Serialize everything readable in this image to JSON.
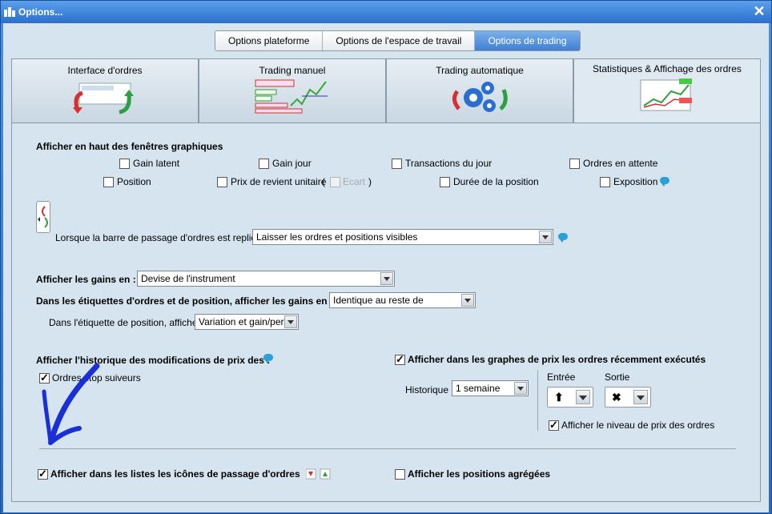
{
  "window": {
    "title": "Options...",
    "close_label": "✕"
  },
  "top_tabs": [
    {
      "label": "Options plateforme"
    },
    {
      "label": "Options de l'espace de travail"
    },
    {
      "label": "Options de trading"
    }
  ],
  "big_tabs": [
    {
      "label": "Interface d'ordres"
    },
    {
      "label": "Trading manuel"
    },
    {
      "label": "Trading automatique"
    },
    {
      "label": "Statistiques & Affichage des ordres"
    }
  ],
  "section_header": {
    "label": "Afficher en haut des fenêtres graphiques"
  },
  "header_checkboxes": {
    "gain_latent": "Gain latent",
    "gain_jour": "Gain jour",
    "transactions_jour": "Transactions du jour",
    "ordres_attente": "Ordres en attente",
    "position": "Position",
    "prix_revient": "Prix de revient unitaire",
    "paren_open": "(",
    "ecart": "Ecart",
    "paren_close": ")",
    "duree_position": "Durée de la position",
    "exposition": "Exposition"
  },
  "collapsed_bar": {
    "label": "Lorsque la barre de passage d'ordres est repliée :",
    "value": "Laisser les ordres et positions visibles"
  },
  "gains": {
    "label": "Afficher les gains en :",
    "value": "Devise de l'instrument"
  },
  "labels_gains": {
    "label": "Dans les étiquettes d'ordres et de position, afficher les gains en :",
    "value": "Identique au reste de l'application"
  },
  "position_label": {
    "label": "Dans l'étiquette de position, afficher :",
    "value": "Variation et gain/perte"
  },
  "history": {
    "label": "Afficher l'historique des modifications de prix des :",
    "stop_label": "Ordres stop suiveurs"
  },
  "executed": {
    "label": "Afficher dans les graphes de prix les ordres récemment exécutés",
    "historique_label": "Historique",
    "historique_value": "1 semaine",
    "entree_label": "Entrée",
    "sortie_label": "Sortie",
    "price_level_label": "Afficher le niveau de prix des ordres"
  },
  "bottom": {
    "icons_label": "Afficher dans les listes les icônes de passage d'ordres",
    "aggregated_label": "Afficher les positions agrégées"
  },
  "colors": {
    "accent": "#3f7fd4",
    "annotation": "#1a2fd6",
    "panel": "#d5e4ee"
  }
}
